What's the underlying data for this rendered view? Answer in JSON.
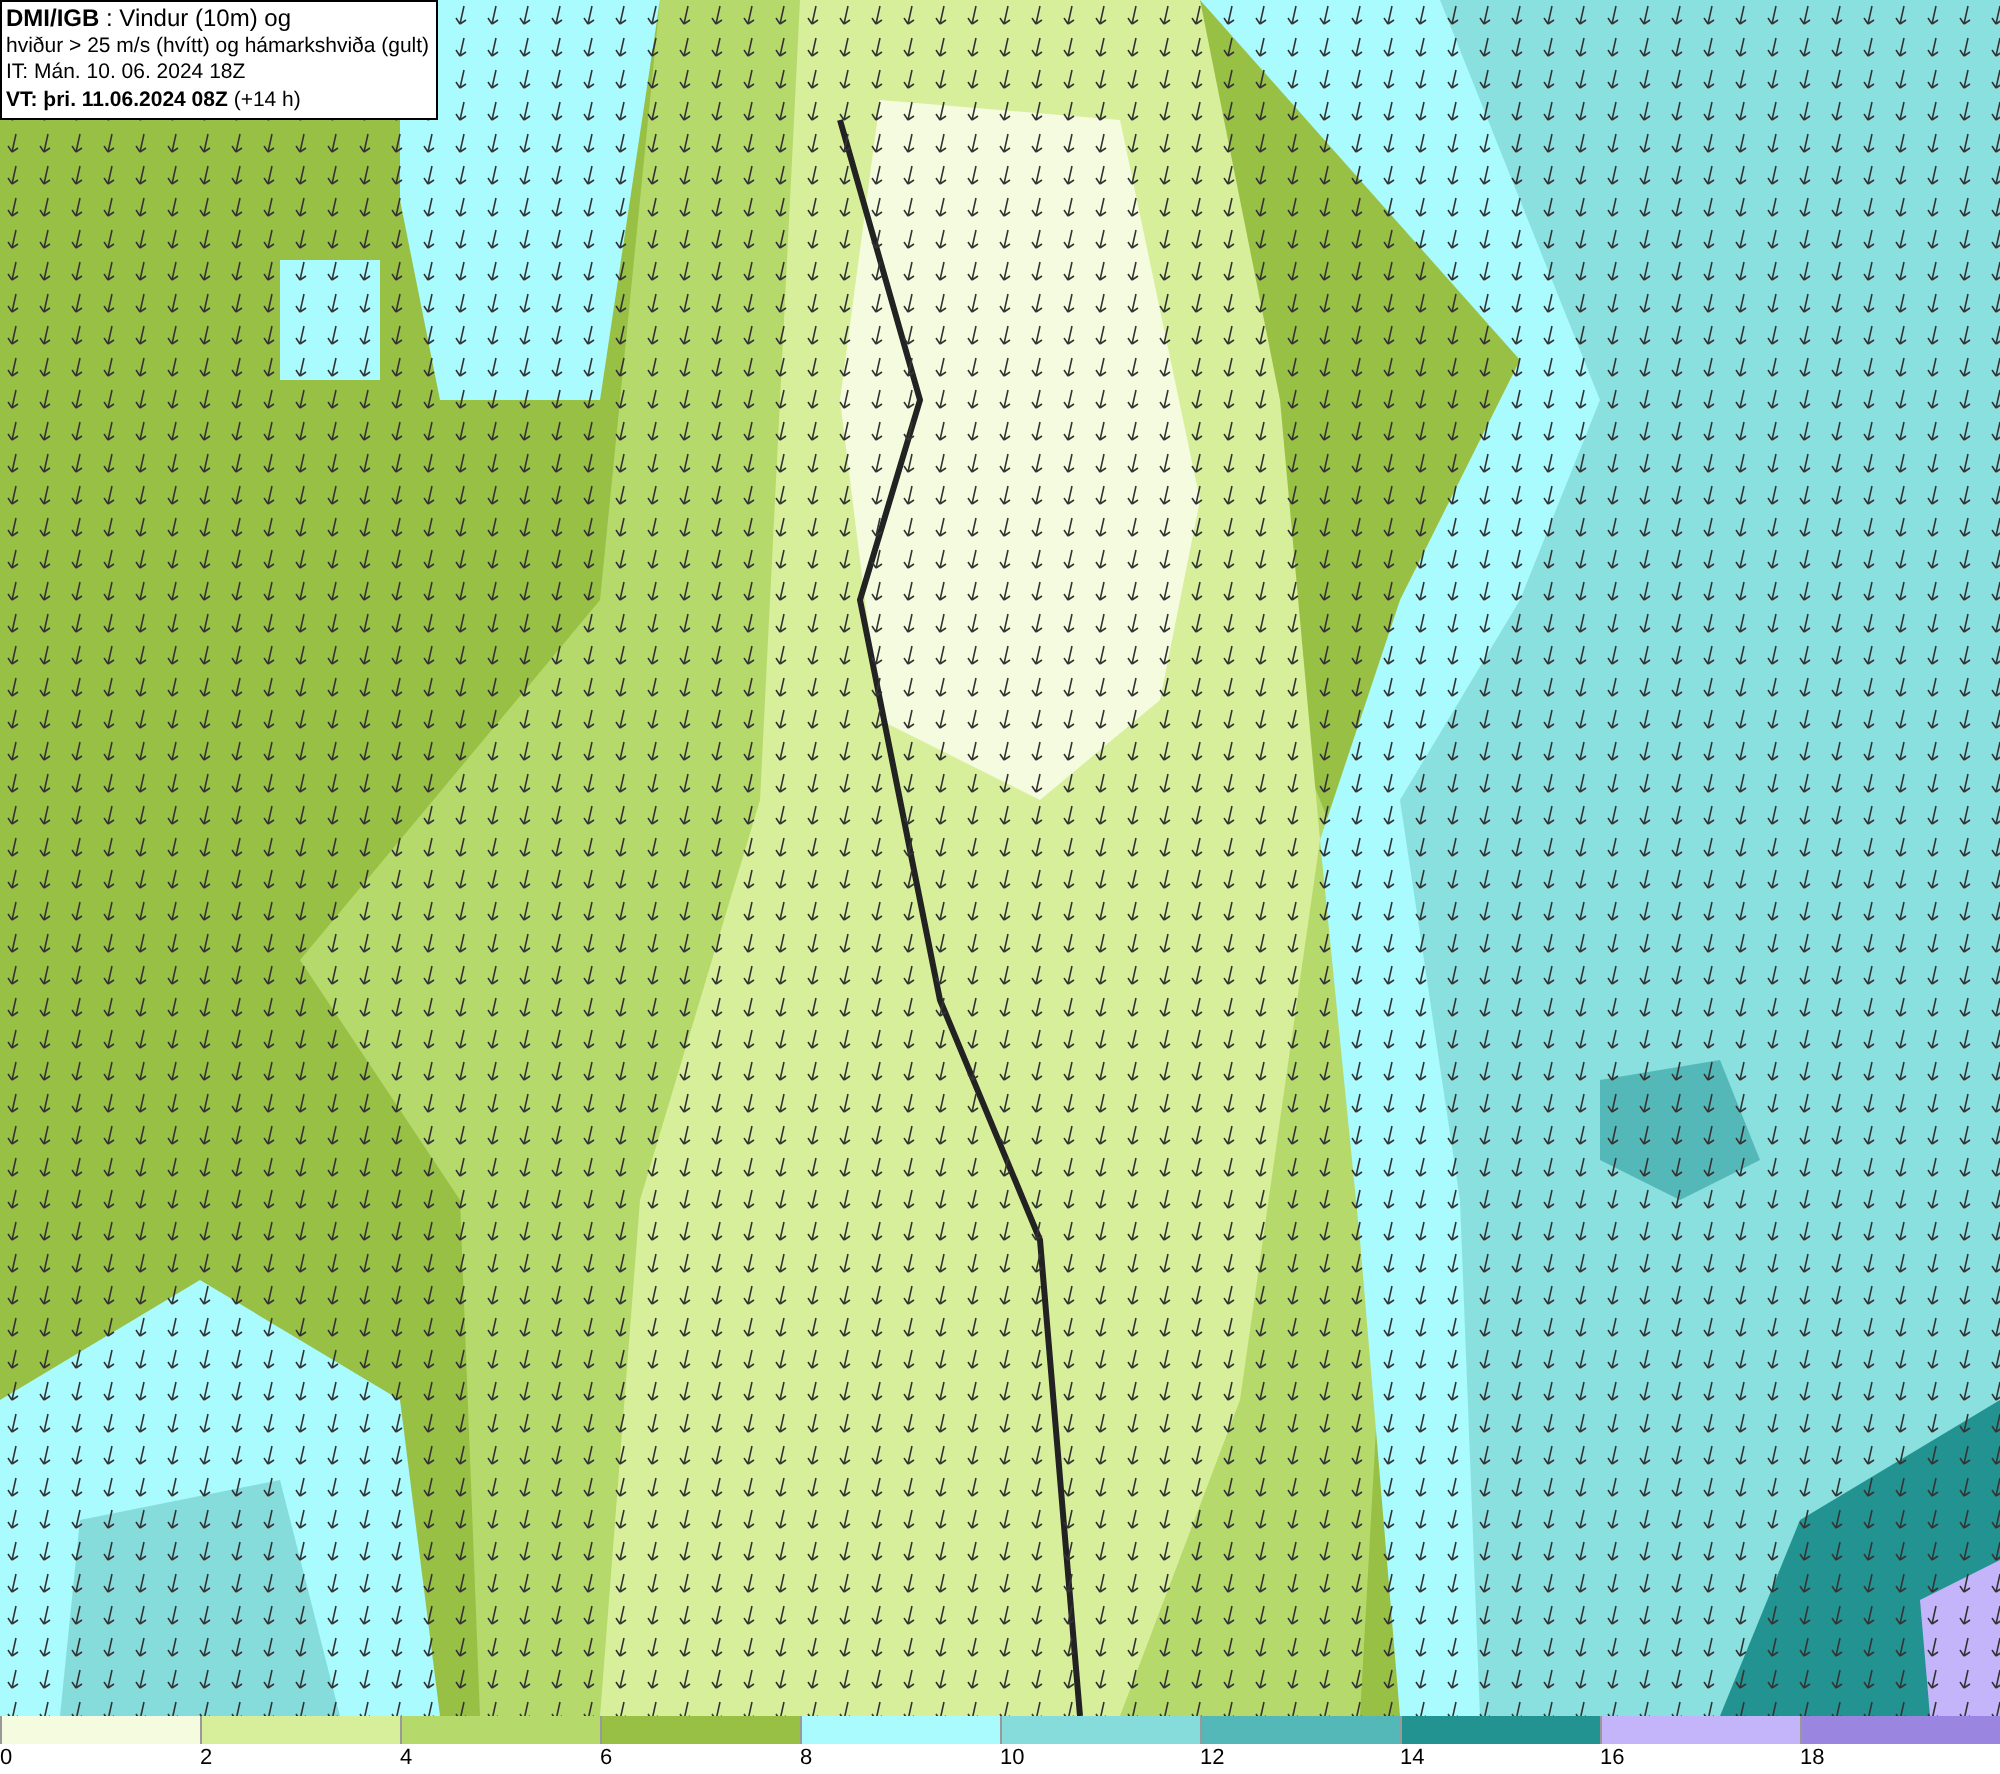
{
  "header": {
    "lines": [
      "**DMI/IGB** : Vindur (10m) og",
      "hviður > 25 m/s (hvítt) og hámarkshviða (gult)",
      "IT: Mán. 10. 06. 2024 18Z",
      "**VT: þri. 11.06.2024 08Z** (+14 h)"
    ]
  },
  "legend": [
    {
      "label": "0",
      "color": "#f5fbdf"
    },
    {
      "label": "2",
      "color": "#d7ef9b"
    },
    {
      "label": "4",
      "color": "#b5d96a"
    },
    {
      "label": "6",
      "color": "#98c045"
    },
    {
      "label": "8",
      "color": "#a9fbfd"
    },
    {
      "label": "10",
      "color": "#86dbdb"
    },
    {
      "label": "12",
      "color": "#55b8b8"
    },
    {
      "label": "14",
      "color": "#229390"
    },
    {
      "label": "16",
      "color": "#c4b5fb"
    },
    {
      "label": "18",
      "color": "#9a85e0"
    }
  ]
}
